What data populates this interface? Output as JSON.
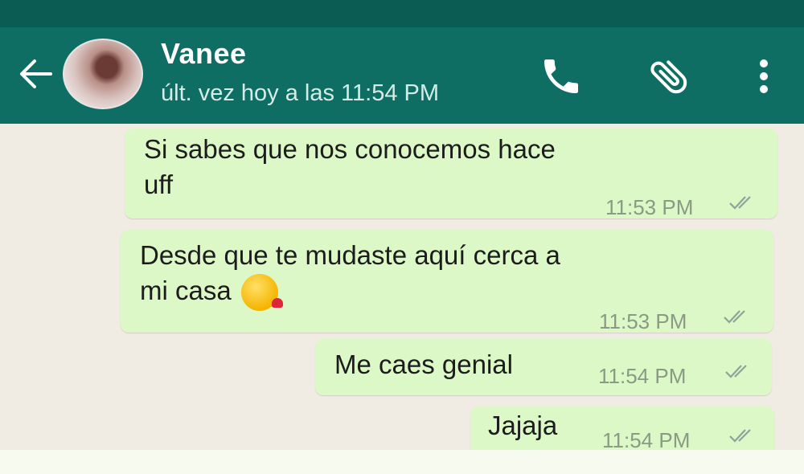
{
  "header": {
    "contact_name": "Vanee",
    "last_seen": "últ. vez hoy a las 11:54 PM",
    "icons": [
      "back-arrow-icon",
      "avatar",
      "phone-icon",
      "paperclip-icon",
      "more-vert-icon"
    ]
  },
  "messages": [
    {
      "text": "Si sabes que nos conocemos hace\nuff",
      "time": "11:53 PM",
      "status": "delivered"
    },
    {
      "text": "Desde que te mudaste aquí  cerca a\nmi casa",
      "time": "11:53 PM",
      "status": "delivered",
      "emoji": "face-blowing-kiss"
    },
    {
      "text": "Me caes genial",
      "time": "11:54 PM",
      "status": "delivered"
    },
    {
      "text": "Jajaja",
      "time": "11:54 PM",
      "status": "delivered"
    }
  ],
  "colors": {
    "header": "#0f6e64",
    "bubble_out": "#dcf8c6",
    "background": "#f0ece4"
  }
}
